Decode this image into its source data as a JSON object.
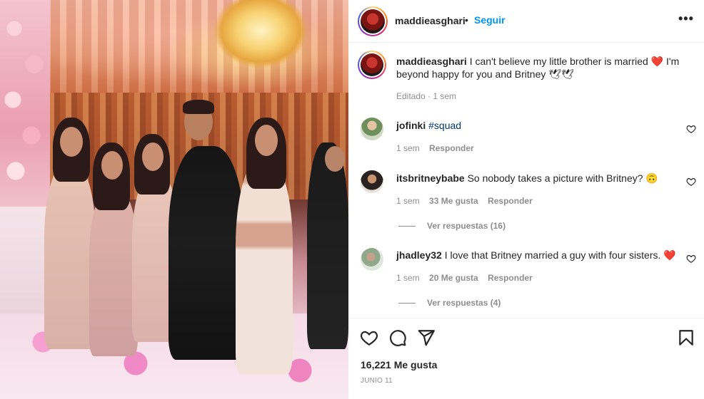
{
  "post": {
    "author": "maddieasghari",
    "follow_dot": "•",
    "follow_label": "Seguir",
    "more_label": "•••",
    "caption": "I can't believe my little brother is married ❤️ I'm beyond happy for you and Britney 🕊🕊",
    "caption_meta": "Editado · 1 sem"
  },
  "comments": [
    {
      "user": "jofinki",
      "text": "",
      "hashtag": "#squad",
      "time": "1 sem",
      "likes": "",
      "reply_label": "Responder",
      "view_replies": ""
    },
    {
      "user": "itsbritneybabe",
      "text": "So nobody takes a picture with Britney? 🙃",
      "hashtag": "",
      "time": "1 sem",
      "likes": "33 Me gusta",
      "reply_label": "Responder",
      "view_replies": "Ver respuestas (16)"
    },
    {
      "user": "jhadley32",
      "text": "I love that Britney married a guy with four sisters. ❤️",
      "hashtag": "",
      "time": "1 sem",
      "likes": "20 Me gusta",
      "reply_label": "Responder",
      "view_replies": "Ver respuestas (4)"
    }
  ],
  "engagement": {
    "likes_label": "16,221 Me gusta",
    "date_label": "JUNIO 11"
  },
  "icons": {
    "like": "heart-icon",
    "comment": "comment-icon",
    "share": "paper-plane-icon",
    "save": "bookmark-icon"
  },
  "colors": {
    "accent": "#0095f6",
    "muted": "#8e8e8e",
    "text": "#262626",
    "heart": "#ed4956"
  }
}
